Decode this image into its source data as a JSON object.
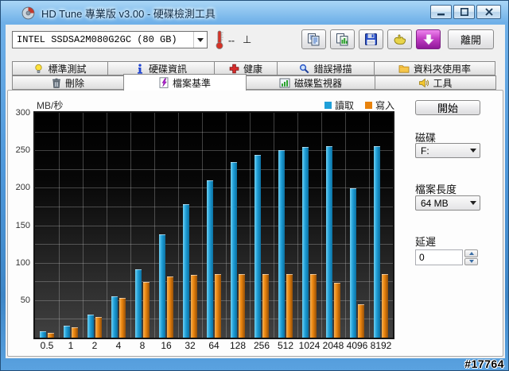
{
  "window": {
    "title": "HD Tune 專業版 v3.00 - 硬碟檢測工具",
    "watermark": "#17764"
  },
  "toolbar": {
    "device": "INTEL SSDSA2M080G2GC (80 GB)",
    "temperature": "--",
    "temp_unit": "⊥",
    "exit": "離開",
    "icon_names": [
      "copy-icon",
      "copy-image-icon",
      "save-icon",
      "hand-icon",
      "download-icon"
    ]
  },
  "tabs": {
    "row1": [
      {
        "label": "標準測試"
      },
      {
        "label": "硬碟資訊"
      },
      {
        "label": "健康"
      },
      {
        "label": "錯誤掃描"
      },
      {
        "label": "資料夾使用率"
      }
    ],
    "row2": [
      {
        "label": "刪除"
      },
      {
        "label": "檔案基準",
        "active": true
      },
      {
        "label": "磁碟監視器"
      },
      {
        "label": "工具"
      }
    ]
  },
  "controls": {
    "start": "開始",
    "disk_label": "磁碟",
    "disk_value": "F:",
    "file_length_label": "檔案長度",
    "file_length_value": "64 MB",
    "delay_label": "延遲",
    "delay_value": "0"
  },
  "chart_data": {
    "type": "bar",
    "title": "",
    "ylabel": "MB/秒",
    "xlabel": "",
    "categories": [
      "0.5",
      "1",
      "2",
      "4",
      "8",
      "16",
      "32",
      "64",
      "128",
      "256",
      "512",
      "1024",
      "2048",
      "4096",
      "8192"
    ],
    "series": [
      {
        "name": "讀取",
        "color": "#1f9fd8",
        "color_light": "#6fd0f2",
        "color_dark": "#0b6f9f",
        "values": [
          8,
          16,
          31,
          55,
          91,
          138,
          178,
          210,
          234,
          244,
          250,
          254,
          256,
          199,
          256
        ]
      },
      {
        "name": "寫入",
        "color": "#e8820c",
        "color_light": "#f7b052",
        "color_dark": "#94500a",
        "values": [
          6,
          14,
          28,
          53,
          74,
          82,
          84,
          85,
          85,
          85,
          85,
          85,
          73,
          45,
          85
        ]
      }
    ],
    "ylim": [
      0,
      300
    ],
    "ytick_major": 50,
    "ytick_minor": 25,
    "grid": true,
    "legend_position": "top-right"
  }
}
